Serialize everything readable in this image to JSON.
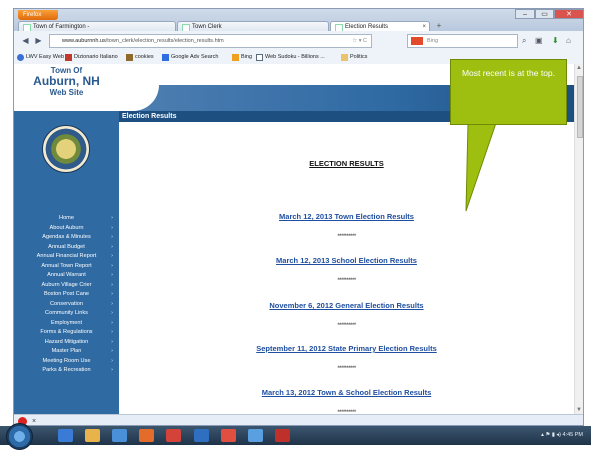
{
  "browser": {
    "app_button": "Firefox",
    "tabs": [
      {
        "label": "Town of Farmington -"
      },
      {
        "label": "Town Clerk"
      },
      {
        "label": "Election Results"
      }
    ],
    "new_tab": "+",
    "window_controls": [
      "–",
      "▭",
      "✕"
    ],
    "url": {
      "host": "www.auburnnh.us",
      "path": "/town_clerk/election_results/election_results.htm"
    },
    "search_placeholder": "Bing",
    "bookmarks": [
      {
        "label": "LWV Easy Web",
        "icon_color": "#3b6fd1"
      },
      {
        "label": "Dizionario Italiano",
        "icon_color": "#c0392b"
      },
      {
        "label": "cookies",
        "icon_color": "#8e6b2a"
      },
      {
        "label": "Google Adv Search",
        "icon_color": "#2d6fe0"
      },
      {
        "label": "Bing",
        "icon_color": "#f0a020"
      },
      {
        "label": "Web Sudoku - Billions ...",
        "icon_color": "#5a6b7d"
      },
      {
        "label": "Politics",
        "icon_color": "#e9c46a"
      }
    ]
  },
  "site": {
    "header_lines": [
      "Town Of",
      "Auburn, NH",
      "Web Site"
    ],
    "home_link": "Home",
    "page_heading": "Election Results",
    "menu": [
      "Home",
      "About Auburn",
      "Agendas & Minutes",
      "Annual Budget",
      "Annual Financial Report",
      "Annual Town Report",
      "Annual Warrant",
      "Auburn Village Crier",
      "Boston Post Cane",
      "Conservation",
      "Community Links",
      "Employment",
      "Forms & Regulations",
      "Hazard Mitigation",
      "Master Plan",
      "Meeting Room Use",
      "Parks & Recreation"
    ]
  },
  "main": {
    "title": "ELECTION RESULTS",
    "results": [
      "March 12, 2013 Town Election Results",
      "March 12, 2013 School Election Results",
      "November 6, 2012 General Election Results",
      "September 11, 2012 State Primary Election Results",
      "March 13, 2012 Town & School Election Results"
    ],
    "separator": "**********"
  },
  "callout": {
    "text": "Most recent is at the top.",
    "color": "#9ebf10"
  },
  "taskbar": {
    "clock": "4:45 PM"
  }
}
